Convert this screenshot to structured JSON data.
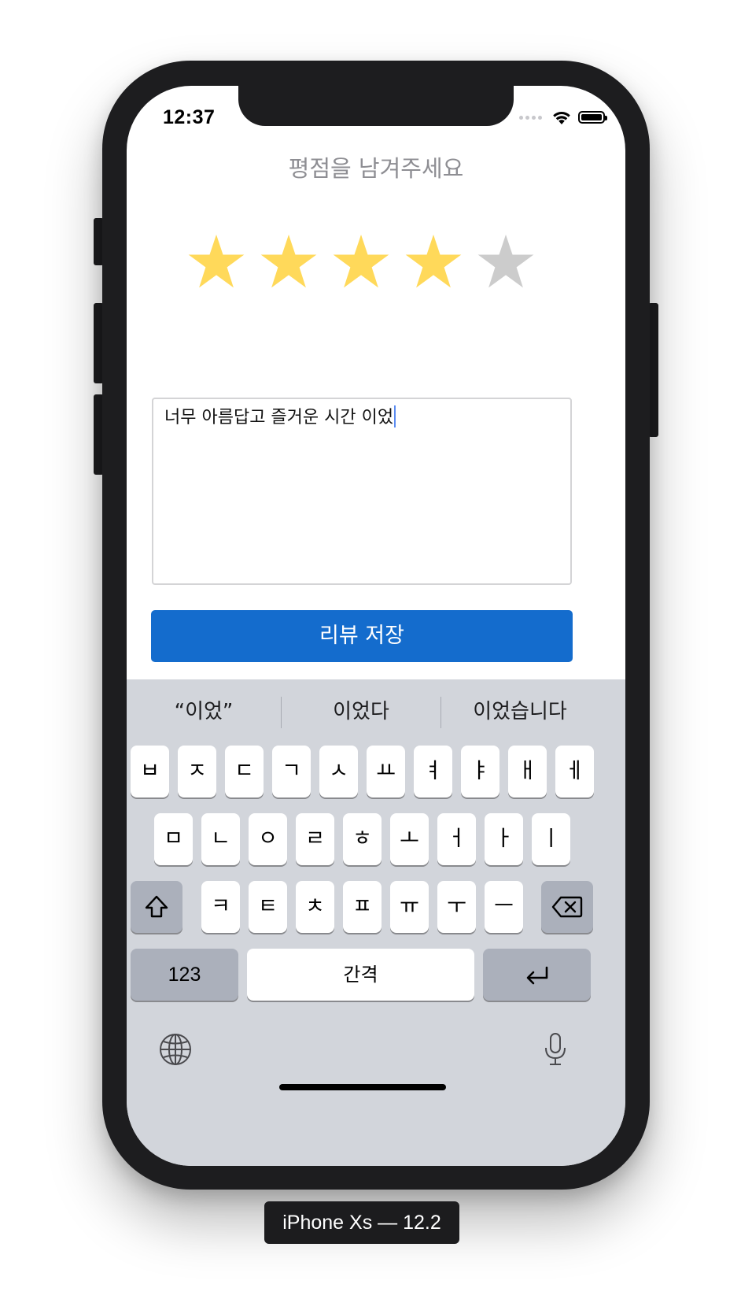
{
  "status_bar": {
    "time": "12:37"
  },
  "app": {
    "prompt": "평점을 남겨주세요",
    "rating": {
      "value": 4,
      "max": 5,
      "filled_color": "#FFD95A",
      "empty_color": "#CCCCCC"
    },
    "review_text": "너무 아름답고 즐거운 시간 이었",
    "save_label": "리뷰 저장",
    "accent_color": "#146CCD"
  },
  "keyboard": {
    "suggestions": [
      "“이었”",
      "이었다",
      "이었습니다"
    ],
    "row1": [
      "ㅂ",
      "ㅈ",
      "ㄷ",
      "ㄱ",
      "ㅅ",
      "ㅛ",
      "ㅕ",
      "ㅑ",
      "ㅐ",
      "ㅔ"
    ],
    "row2": [
      "ㅁ",
      "ㄴ",
      "ㅇ",
      "ㄹ",
      "ㅎ",
      "ㅗ",
      "ㅓ",
      "ㅏ",
      "ㅣ"
    ],
    "row3": [
      "ㅋ",
      "ㅌ",
      "ㅊ",
      "ㅍ",
      "ㅠ",
      "ㅜ",
      "ㅡ"
    ],
    "numbers_label": "123",
    "space_label": "간격",
    "icons": {
      "shift": "shift-icon",
      "delete": "delete-icon",
      "return": "return-icon",
      "globe": "globe-icon",
      "mic": "microphone-icon"
    }
  },
  "simulator_label": "iPhone Xs — 12.2"
}
